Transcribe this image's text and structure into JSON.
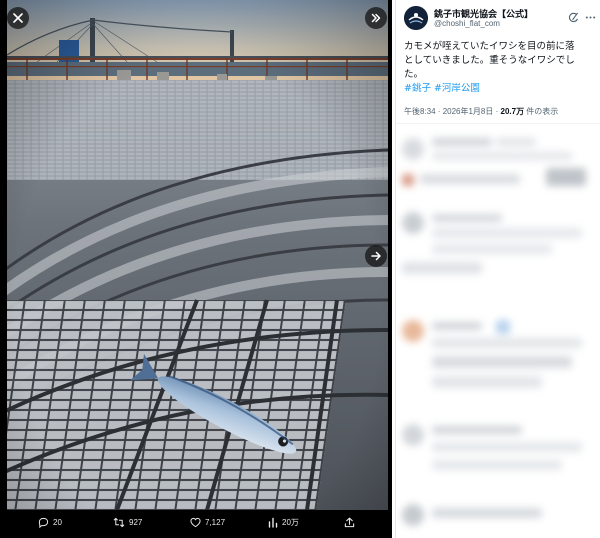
{
  "viewer": {
    "close_icon": "close-icon",
    "expand_icon": "chevron-double-right-icon",
    "next_icon": "arrow-right-icon",
    "actions": {
      "replies": "20",
      "reposts": "927",
      "likes": "7,127",
      "views": "20万"
    }
  },
  "tweet": {
    "author": {
      "display_name": "銚子市観光協会【公式】",
      "handle": "@choshi_flat_com"
    },
    "text_lines": [
      "カモメが咥えていたイワシを目の前に落",
      "としていきました。重そうなイワシでし",
      "た。"
    ],
    "hashtags": [
      "#銚子",
      "#河岸公園"
    ],
    "meta": {
      "time": "午後8:34",
      "separator": " · ",
      "date": "2026年1月8日",
      "separator2": " · ",
      "views": "20.7万",
      "views_suffix": " 件の表示"
    }
  },
  "colors": {
    "link": "#1d9bf0",
    "text": "#0f1419",
    "muted": "#536471",
    "viewer_bg": "#000000"
  }
}
